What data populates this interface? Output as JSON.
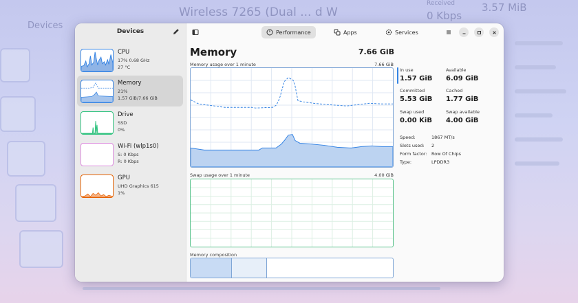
{
  "background": {
    "devices_title": "Devices",
    "ghost_title": "Wireless 7265 (Dual ... d W",
    "received_label": "Received",
    "received_value": "0 Kbps",
    "ghost_mem": "3.57 MiB"
  },
  "sidebar": {
    "title": "Devices",
    "items": [
      {
        "name": "CPU",
        "line1": "17% 0.68 GHz",
        "line2": "27 °C",
        "color": "#3584e4"
      },
      {
        "name": "Memory",
        "line1": "21%",
        "line2": "1.57 GiB/7.66 GiB",
        "color": "#3584e4"
      },
      {
        "name": "Drive",
        "line1": "SSD",
        "line2": "0%",
        "color": "#2ec27e"
      },
      {
        "name": "Wi-Fi (wlp1s0)",
        "line1": "S: 0 Kbps",
        "line2": "R: 0 Kbps",
        "color": "#dc8add"
      },
      {
        "name": "GPU",
        "line1": "UHD Graphics 615",
        "line2": "1%",
        "color": "#e66100"
      }
    ]
  },
  "header": {
    "tabs": [
      {
        "label": "Performance",
        "icon": "gauge-icon"
      },
      {
        "label": "Apps",
        "icon": "apps-icon"
      },
      {
        "label": "Services",
        "icon": "gear-icon"
      }
    ]
  },
  "memory": {
    "title": "Memory",
    "total": "7.66 GiB",
    "usage_caption": "Memory usage over 1 minute",
    "usage_max": "7.66 GiB",
    "swap_caption": "Swap usage over 1 minute",
    "swap_max": "4.00 GiB",
    "composition_caption": "Memory composition",
    "stats": {
      "in_use_label": "In use",
      "in_use": "1.57 GiB",
      "available_label": "Available",
      "available": "6.09 GiB",
      "committed_label": "Committed",
      "committed": "5.53 GiB",
      "cached_label": "Cached",
      "cached": "1.77 GiB",
      "swap_used_label": "Swap used",
      "swap_used": "0.00 KiB",
      "swap_available_label": "Swap available",
      "swap_available": "4.00 GiB"
    },
    "details": [
      {
        "key": "Speed:",
        "value": "1867 MT/s"
      },
      {
        "key": "Slots used:",
        "value": "2"
      },
      {
        "key": "Form factor:",
        "value": "Row Of Chips"
      },
      {
        "key": "Type:",
        "value": "LPDDR3"
      }
    ],
    "colors": {
      "memory": "#3584e4",
      "swap": "#2ec27e"
    }
  }
}
